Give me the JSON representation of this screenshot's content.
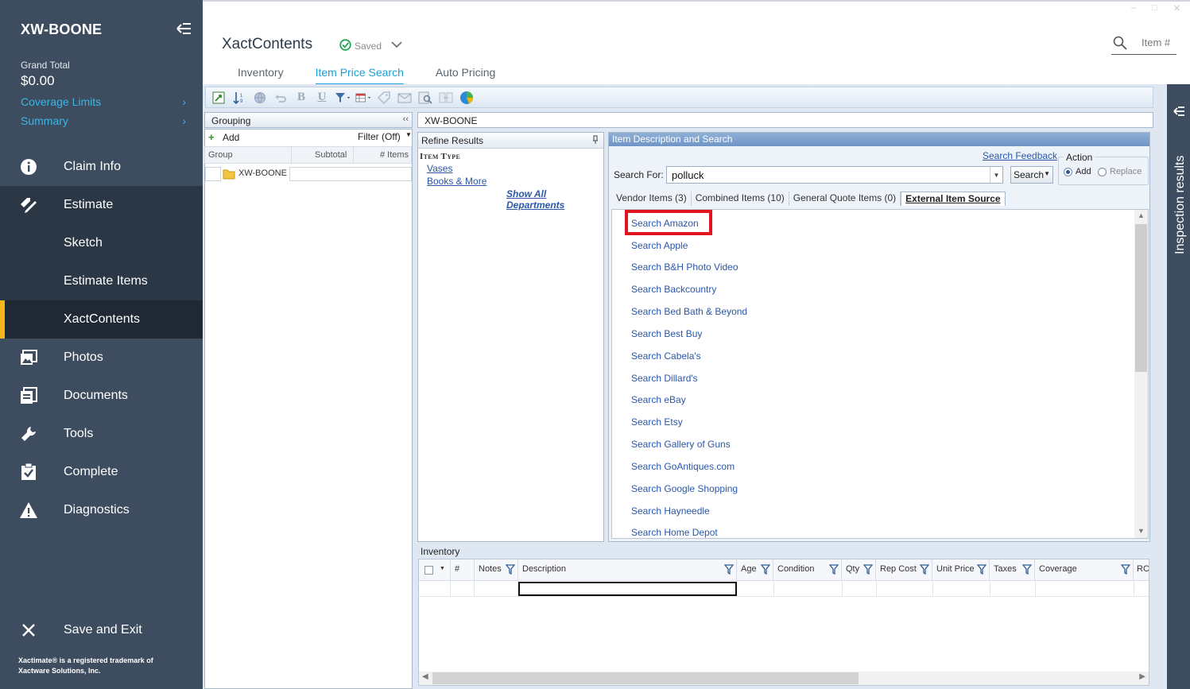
{
  "sidebar": {
    "title": "XW-BOONE",
    "grand_total_label": "Grand Total",
    "grand_total_value": "$0.00",
    "links": [
      {
        "label": "Coverage Limits"
      },
      {
        "label": "Summary"
      }
    ],
    "nav": [
      {
        "label": "Claim Info",
        "icon": "info-icon"
      },
      {
        "label": "Estimate",
        "icon": "pencil-tag-icon"
      },
      {
        "label": "Sketch"
      },
      {
        "label": "Estimate Items"
      },
      {
        "label": "XactContents"
      },
      {
        "label": "Photos",
        "icon": "photos-icon"
      },
      {
        "label": "Documents",
        "icon": "documents-icon"
      },
      {
        "label": "Tools",
        "icon": "wrench-icon"
      },
      {
        "label": "Complete",
        "icon": "clipboard-check-icon"
      },
      {
        "label": "Diagnostics",
        "icon": "warning-icon"
      }
    ],
    "save_exit": "Save and Exit",
    "footer_line1": "Xactimate® is a registered trademark of",
    "footer_line2": "Xactware Solutions, Inc.",
    "active_accent": "#f5b51b"
  },
  "header": {
    "app_title": "XactContents",
    "saved_label": "Saved",
    "search_placeholder": "Item #",
    "tabs": [
      {
        "label": "Inventory",
        "active": false
      },
      {
        "label": "Item Price Search",
        "active": true
      },
      {
        "label": "Auto Pricing",
        "active": false
      }
    ],
    "accent": "#1aa0d6"
  },
  "grouping": {
    "title": "Grouping",
    "add_label": "Add",
    "filter_label": "Filter (Off)",
    "columns": [
      "Group",
      "Subtotal",
      "# Items"
    ],
    "rows": [
      {
        "group": "XW-BOONE",
        "subtotal": "",
        "items": ""
      }
    ]
  },
  "breadcrumb": "XW-BOONE",
  "refine": {
    "title": "Refine Results",
    "item_type_label": "Item Type",
    "links": [
      "Vases",
      "Books & More"
    ],
    "show_all": "Show All Departments"
  },
  "item_search": {
    "title": "Item Description and Search",
    "feedback_link": "Search Feedback",
    "search_for_label": "Search For:",
    "search_value": "polluck",
    "search_button": "Search",
    "action_label": "Action",
    "action_options": [
      {
        "label": "Add",
        "selected": true
      },
      {
        "label": "Replace",
        "selected": false
      }
    ],
    "subtabs": [
      {
        "label": "Vendor Items (3)",
        "active": false
      },
      {
        "label": "Combined Items (10)",
        "active": false
      },
      {
        "label": "General Quote Items (0)",
        "active": false
      },
      {
        "label": "External Item Source",
        "active": true
      }
    ],
    "external_sources": [
      "Search Amazon",
      "Search Apple",
      "Search B&H Photo Video",
      "Search Backcountry",
      "Search Bed Bath & Beyond",
      "Search Best Buy",
      "Search Cabela's",
      "Search Dillard's",
      "Search eBay",
      "Search Etsy",
      "Search Gallery of Guns",
      "Search GoAntiques.com",
      "Search Google Shopping",
      "Search Hayneedle",
      "Search Home Depot"
    ],
    "highlight_color": "#e0141e"
  },
  "inventory": {
    "title": "Inventory",
    "columns": [
      "#",
      "Notes",
      "Description",
      "Age",
      "Condition",
      "Qty",
      "Rep Cost",
      "Unit Price",
      "Taxes",
      "Coverage",
      "RC"
    ]
  },
  "inspection_panel": {
    "label": "Inspection results"
  }
}
